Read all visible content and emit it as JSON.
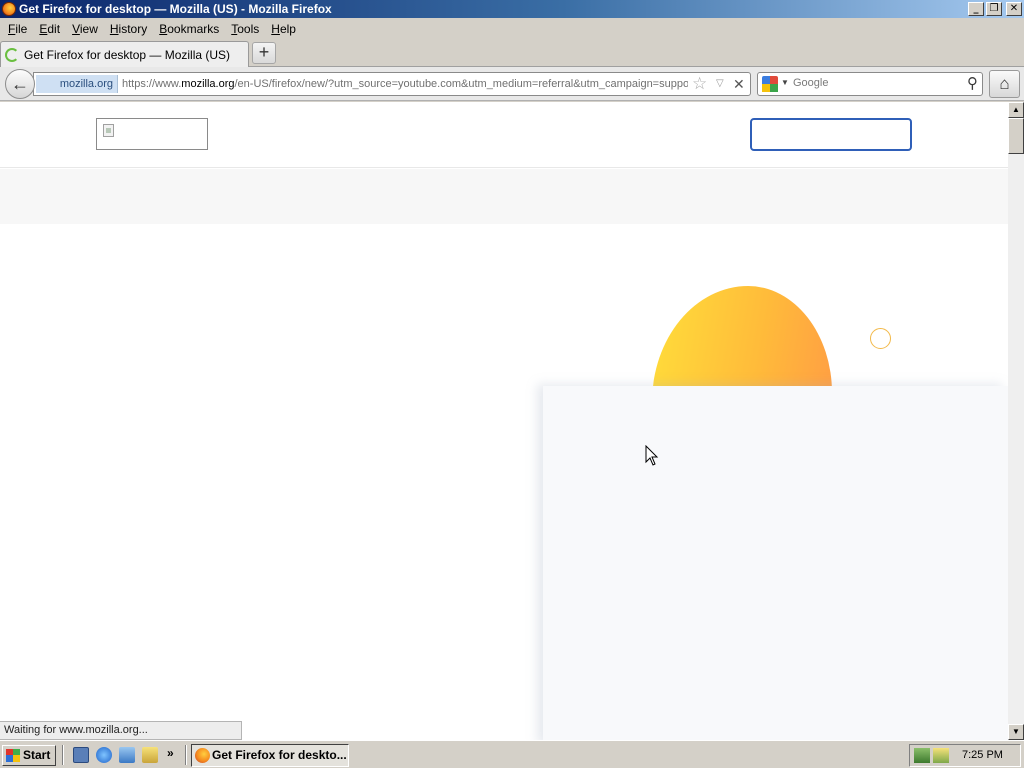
{
  "window": {
    "title": "Get Firefox for desktop — Mozilla (US) - Mozilla Firefox",
    "minimize_glyph": "_",
    "maximize_glyph": "❐",
    "close_glyph": "✕"
  },
  "menubar": {
    "items": [
      {
        "key": "F",
        "rest": "ile"
      },
      {
        "key": "E",
        "rest": "dit"
      },
      {
        "key": "V",
        "rest": "iew"
      },
      {
        "key": "H",
        "rest": "istory"
      },
      {
        "key": "B",
        "rest": "ookmarks"
      },
      {
        "key": "T",
        "rest": "ools"
      },
      {
        "key": "H",
        "rest": "elp"
      }
    ]
  },
  "tabs": {
    "active_label": "Get Firefox for desktop — Mozilla (US)",
    "new_tab_glyph": "+"
  },
  "navbar": {
    "back_glyph": "←",
    "identity_label": "mozilla.org",
    "url_prefix": "https://www.",
    "url_host": "mozilla.org",
    "url_rest": "/en-US/firefox/new/?utm_source=youtube.com&utm_medium=referral&utm_campaign=suppo",
    "star_glyph": "☆",
    "dropdown_glyph": "▽",
    "stop_glyph": "✕",
    "search_placeholder": "Google",
    "search_dropdown_glyph": "▼",
    "magnifier_glyph": "⚲",
    "home_glyph": "⌂"
  },
  "statusbar": {
    "text": "Waiting for www.mozilla.org..."
  },
  "taskbar": {
    "start_label": "Start",
    "chevron_glyph": "»",
    "task_label": "Get Firefox for deskto...",
    "clock": "7:25 PM"
  },
  "colors": {
    "accent_blue": "#2f5fb8",
    "blob_yellow": "#ffde3a",
    "blob_orange": "#ff9a45"
  }
}
